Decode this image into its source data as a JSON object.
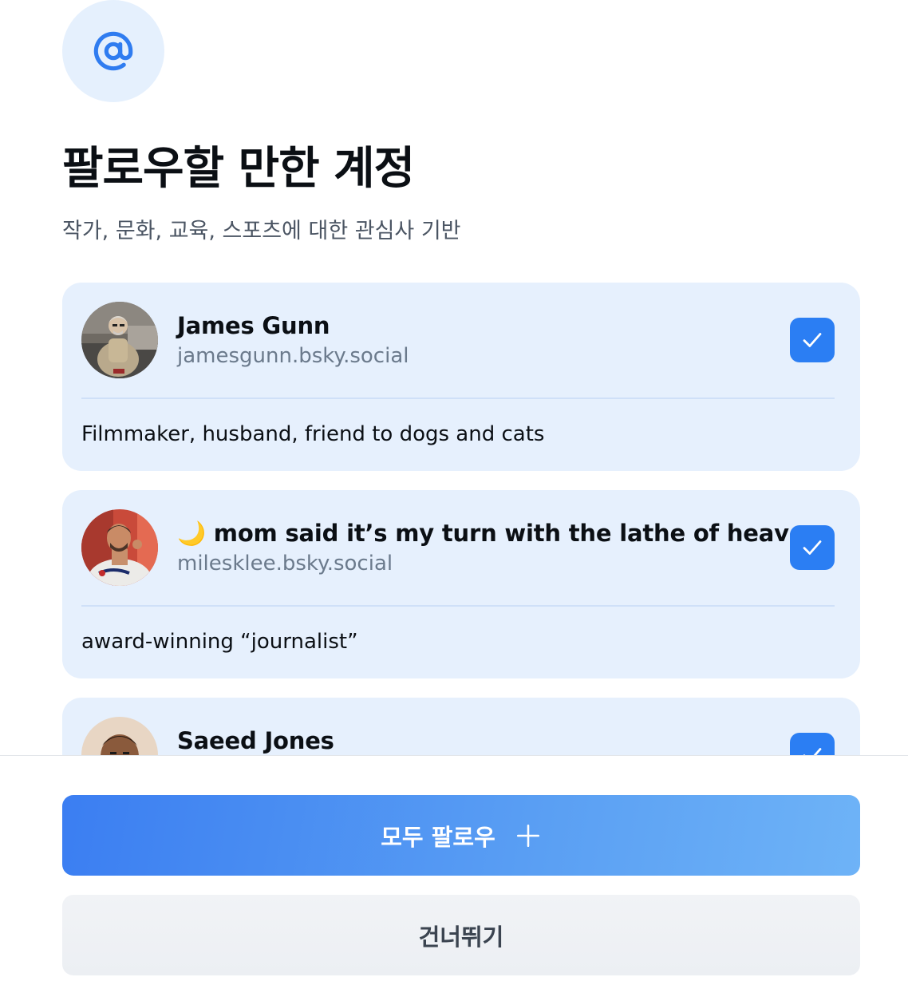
{
  "header": {
    "icon": "at-sign-icon",
    "title": "팔로우할 만한 계정",
    "subtitle": "작가, 문화, 교육, 스포츠에 대한 관심사 기반"
  },
  "accounts": [
    {
      "name": "James Gunn",
      "handle": "jamesgunn.bsky.social",
      "bio": "Filmmaker, husband, friend to dogs and cats",
      "selected": true
    },
    {
      "name": "🌙 mom said it’s my turn with the lathe of heaven",
      "handle": "milesklee.bsky.social",
      "bio": "award-winning “journalist”",
      "selected": true
    },
    {
      "name": "Saeed Jones",
      "handle": "",
      "bio": "",
      "selected": true
    }
  ],
  "actions": {
    "follow_all_label": "모두 팔로우",
    "skip_label": "건너뛰기"
  },
  "colors": {
    "accent": "#2b7ef3",
    "card_background": "#e6f0fd",
    "icon_circle": "#e5f0fd"
  }
}
